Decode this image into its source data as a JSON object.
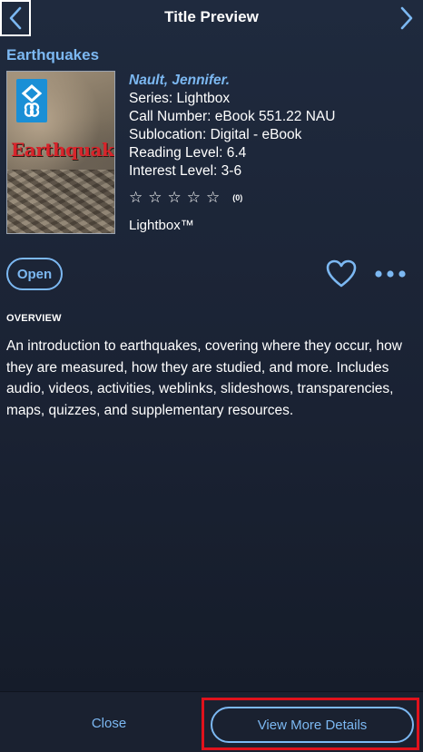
{
  "header": {
    "title": "Title Preview",
    "back_icon": "chevron-left-icon",
    "next_icon": "chevron-right-icon"
  },
  "book": {
    "title": "Earthquakes",
    "cover_title": "Earthquakes",
    "author": "Nault, Jennifer.",
    "series": "Series: Lightbox",
    "call_number": "Call Number: eBook 551.22 NAU",
    "sublocation": "Sublocation: Digital - eBook",
    "reading_level": "Reading Level: 6.4",
    "interest_level": "Interest Level: 3-6",
    "rating_stars": 0,
    "rating_count": "(0)",
    "brand": "Lightbox™"
  },
  "actions": {
    "open_label": "Open",
    "favorite_icon": "heart-icon",
    "more_icon": "more-dots-icon"
  },
  "overview": {
    "heading": "OVERVIEW",
    "text": "An introduction to earthquakes, covering where they occur, how they are measured, how they are studied, and more. Includes audio, videos, activities, weblinks, slideshows, transparencies, maps, quizzes, and supplementary resources."
  },
  "footer": {
    "close_label": "Close",
    "details_label": "View More Details"
  },
  "colors": {
    "accent": "#7cb8f2",
    "background": "#1c2436",
    "highlight": "#e0121c",
    "cover_title": "#d8242b"
  }
}
